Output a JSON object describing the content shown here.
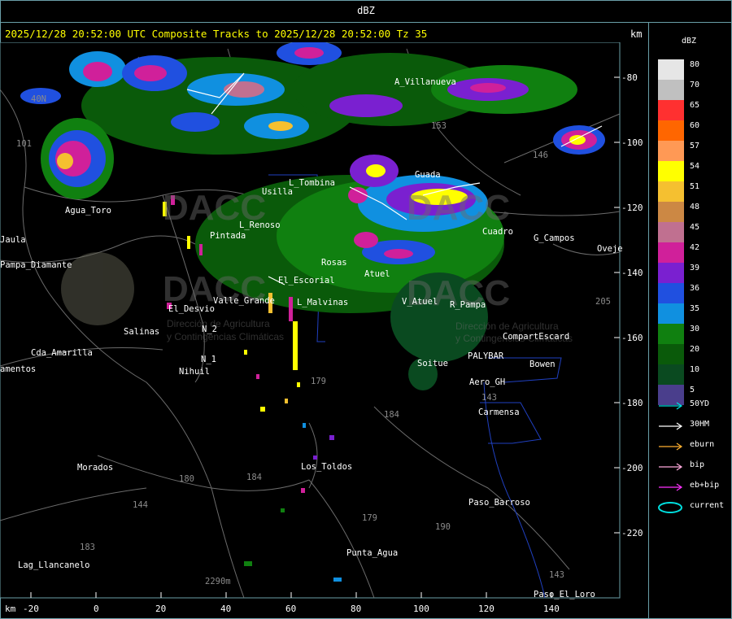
{
  "window_title": "dBZ",
  "header": {
    "text": "2025/12/28 20:52:00 UTC Composite Tracks to 2025/12/28 20:52:00 Tz 35",
    "km_label": "km"
  },
  "x_axis": {
    "label": "km",
    "ticks": [
      "-20",
      "0",
      "20",
      "40",
      "60",
      "80",
      "100",
      "120",
      "140"
    ]
  },
  "y_axis": {
    "ticks": [
      "-80",
      "-100",
      "-120",
      "-140",
      "-160",
      "-180",
      "-200",
      "-220"
    ]
  },
  "legend": {
    "title": "dBZ",
    "levels": [
      {
        "value": "80",
        "color": "#e6e6e6"
      },
      {
        "value": "70",
        "color": "#c0c0c0"
      },
      {
        "value": "65",
        "color": "#ff3030"
      },
      {
        "value": "60",
        "color": "#ff6600"
      },
      {
        "value": "57",
        "color": "#ff9955"
      },
      {
        "value": "54",
        "color": "#ffff00"
      },
      {
        "value": "51",
        "color": "#f5c030"
      },
      {
        "value": "48",
        "color": "#cc8844"
      },
      {
        "value": "45",
        "color": "#c07090"
      },
      {
        "value": "42",
        "color": "#d0209a"
      },
      {
        "value": "39",
        "color": "#7a20d0"
      },
      {
        "value": "36",
        "color": "#2050e0"
      },
      {
        "value": "35",
        "color": "#1090e0"
      },
      {
        "value": "30",
        "color": "#108010"
      },
      {
        "value": "20",
        "color": "#0a5a0a"
      },
      {
        "value": "10",
        "color": "#0a4a20"
      },
      {
        "value": "5",
        "color": "#4a3e8c"
      }
    ],
    "tracks": [
      {
        "label": "50YD",
        "color": "#00e0e0"
      },
      {
        "label": "30HM",
        "color": "#ffffff"
      },
      {
        "label": "eburn",
        "color": "#ffb030"
      },
      {
        "label": "bip",
        "color": "#ffaadd"
      },
      {
        "label": "eb+bip",
        "color": "#ff30ff"
      },
      {
        "label": "current",
        "color": "#00e0e0"
      }
    ]
  },
  "places": [
    {
      "name": "A_Villanueva"
    },
    {
      "name": "Guada"
    },
    {
      "name": "Usilla"
    },
    {
      "name": "L_Tombina"
    },
    {
      "name": "Agua_Toro"
    },
    {
      "name": "Jaula"
    },
    {
      "name": "Pampa_Diamante"
    },
    {
      "name": "El_Desvio"
    },
    {
      "name": "Valle_Grande"
    },
    {
      "name": "Salinas"
    },
    {
      "name": "Cda_Amarilla"
    },
    {
      "name": "amentos"
    },
    {
      "name": "N_2"
    },
    {
      "name": "N_1"
    },
    {
      "name": "Nihuil"
    },
    {
      "name": "L_Malvinas"
    },
    {
      "name": "El_Escorial"
    },
    {
      "name": "V_Atuel"
    },
    {
      "name": "R_Pampa"
    },
    {
      "name": "G_Campos"
    },
    {
      "name": "Oveje"
    },
    {
      "name": "CompartEscard"
    },
    {
      "name": "Bowen"
    },
    {
      "name": "Soitue"
    },
    {
      "name": "PALYBAR"
    },
    {
      "name": "Aero_GH"
    },
    {
      "name": "Carmensa"
    },
    {
      "name": "Los_Toldos"
    },
    {
      "name": "Morados"
    },
    {
      "name": "Paso_Barroso"
    },
    {
      "name": "Punta_Agua"
    },
    {
      "name": "Lag_Llancanelo"
    },
    {
      "name": "Paso_El_Loro"
    },
    {
      "name": "Pintada"
    },
    {
      "name": "Rosas"
    },
    {
      "name": "Atuel"
    },
    {
      "name": "Cuadro"
    },
    {
      "name": "L_Renoso"
    }
  ],
  "route_numbers": [
    "40N",
    "101",
    "146",
    "179",
    "184",
    "180",
    "184",
    "183",
    "179",
    "190",
    "143",
    "205",
    "144",
    "143",
    "153",
    "2290m"
  ],
  "watermarks": [
    "DACC",
    "DACC",
    "DACC",
    "DACC"
  ],
  "watermark_texts": [
    "Dirección de Agricultura",
    "y Contingencias Climáticas"
  ]
}
